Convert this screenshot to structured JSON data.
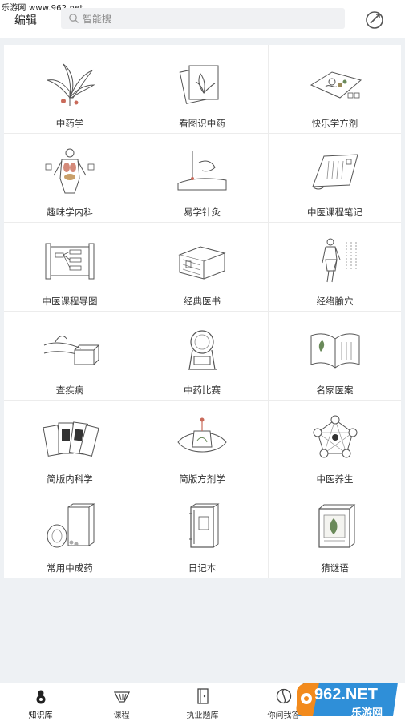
{
  "header": {
    "watermark": "乐游网 www.962.net",
    "edit_label": "编辑",
    "search_placeholder": "智能搜"
  },
  "grid": [
    {
      "label": "中药学",
      "icon": "herb-plant-icon"
    },
    {
      "label": "看图识中药",
      "icon": "herb-cards-icon"
    },
    {
      "label": "快乐学方剂",
      "icon": "prescription-cloth-icon"
    },
    {
      "label": "趣味学内科",
      "icon": "body-organs-icon"
    },
    {
      "label": "易学针灸",
      "icon": "acupuncture-needle-icon"
    },
    {
      "label": "中医课程笔记",
      "icon": "notes-scroll-icon"
    },
    {
      "label": "中医课程导图",
      "icon": "mind-map-scroll-icon"
    },
    {
      "label": "经典医书",
      "icon": "classic-books-icon"
    },
    {
      "label": "经络腧穴",
      "icon": "meridian-figure-icon"
    },
    {
      "label": "查疾病",
      "icon": "pulse-diagnosis-icon"
    },
    {
      "label": "中药比赛",
      "icon": "trophy-cup-icon"
    },
    {
      "label": "名家医案",
      "icon": "open-book-icon"
    },
    {
      "label": "简版内科学",
      "icon": "card-stack-icon"
    },
    {
      "label": "简版方剂学",
      "icon": "herb-bag-icon"
    },
    {
      "label": "中医养生",
      "icon": "five-elements-icon"
    },
    {
      "label": "常用中成药",
      "icon": "medicine-jar-icon"
    },
    {
      "label": "日记本",
      "icon": "diary-notebook-icon"
    },
    {
      "label": "猜谜语",
      "icon": "riddle-box-icon"
    }
  ],
  "tabs": [
    {
      "label": "知识库",
      "icon": "gourd-icon",
      "active": true
    },
    {
      "label": "课程",
      "icon": "fan-icon",
      "active": false
    },
    {
      "label": "执业题库",
      "icon": "question-book-icon",
      "active": false
    },
    {
      "label": "你问我答",
      "icon": "yin-yang-icon",
      "active": false
    },
    {
      "label": "",
      "icon": "user-icon",
      "active": false
    }
  ],
  "badge": {
    "brand": "962.NET",
    "sub": "乐游网"
  },
  "colors": {
    "page_bg": "#eef1f4",
    "card_bg": "#ffffff",
    "divider": "#ececec",
    "badge_blue": "#2f8fd8",
    "badge_orange": "#f28a1c"
  }
}
